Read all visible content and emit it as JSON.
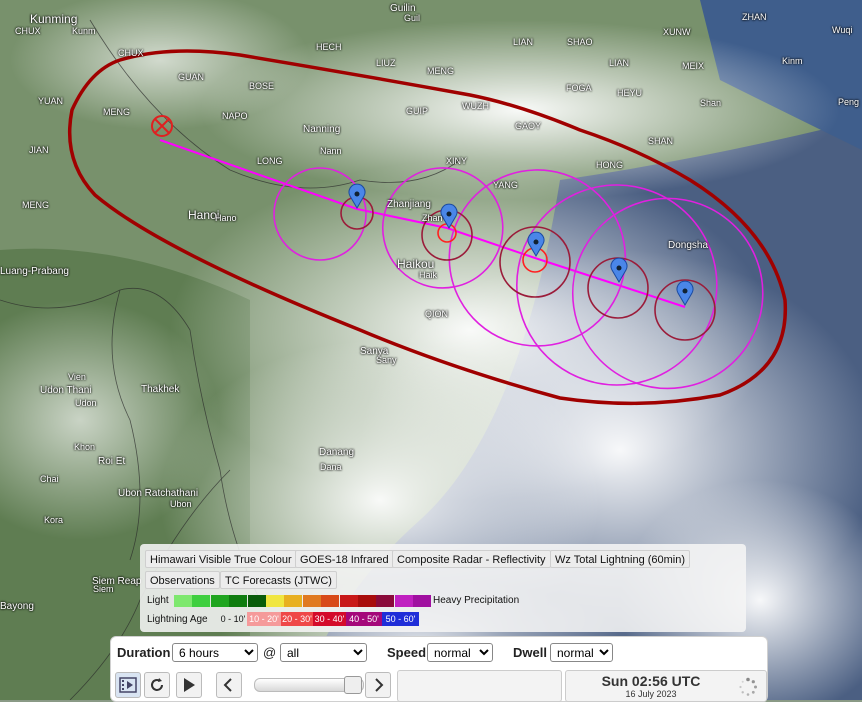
{
  "map": {
    "labels": [
      {
        "text": "Kunming",
        "cls": "big"
      },
      {
        "text": "CHUX",
        "cls": "small"
      },
      {
        "text": "Kunm",
        "cls": "small"
      },
      {
        "text": "CHUX",
        "cls": "small"
      },
      {
        "text": "GUAN",
        "cls": "small"
      },
      {
        "text": "YUAN",
        "cls": "small"
      },
      {
        "text": "MENG",
        "cls": "small"
      },
      {
        "text": "JIAN",
        "cls": "small"
      },
      {
        "text": "MENG",
        "cls": "small"
      },
      {
        "text": "Luang-Prabang",
        "cls": ""
      },
      {
        "text": "HECH",
        "cls": "small"
      },
      {
        "text": "BOSE",
        "cls": "small"
      },
      {
        "text": "NAPO",
        "cls": "small"
      },
      {
        "text": "Nanning",
        "cls": ""
      },
      {
        "text": "Nann",
        "cls": "small"
      },
      {
        "text": "LONG",
        "cls": "small"
      },
      {
        "text": "Hanoi",
        "cls": "big"
      },
      {
        "text": "Hano",
        "cls": "small"
      },
      {
        "text": "Guilin",
        "cls": ""
      },
      {
        "text": "Guil",
        "cls": "small"
      },
      {
        "text": "LIUZ",
        "cls": "small"
      },
      {
        "text": "MENG",
        "cls": "small"
      },
      {
        "text": "GUIP",
        "cls": "small"
      },
      {
        "text": "WUZH",
        "cls": "small"
      },
      {
        "text": "LIAN",
        "cls": "small"
      },
      {
        "text": "SHAO",
        "cls": "small"
      },
      {
        "text": "LIAN",
        "cls": "small"
      },
      {
        "text": "FOGA",
        "cls": "small"
      },
      {
        "text": "HEYU",
        "cls": "small"
      },
      {
        "text": "GAOY",
        "cls": "small"
      },
      {
        "text": "XINY",
        "cls": "small"
      },
      {
        "text": "YANG",
        "cls": "small"
      },
      {
        "text": "HONG",
        "cls": "small"
      },
      {
        "text": "SHAN",
        "cls": "small"
      },
      {
        "text": "Zhanjiang",
        "cls": ""
      },
      {
        "text": "Zhan",
        "cls": "small"
      },
      {
        "text": "Haikou",
        "cls": "big"
      },
      {
        "text": "Haik",
        "cls": "small"
      },
      {
        "text": "QION",
        "cls": "small"
      },
      {
        "text": "Sanya",
        "cls": ""
      },
      {
        "text": "Sany",
        "cls": "small"
      },
      {
        "text": "Dongsha",
        "cls": ""
      },
      {
        "text": "ZHAN",
        "cls": "small"
      },
      {
        "text": "XUNW",
        "cls": "small"
      },
      {
        "text": "MEIX",
        "cls": "small"
      },
      {
        "text": "Shan",
        "cls": "small"
      },
      {
        "text": "Wuqi",
        "cls": "small"
      },
      {
        "text": "Kinm",
        "cls": "small"
      },
      {
        "text": "Peng",
        "cls": "small"
      },
      {
        "text": "Vien",
        "cls": "small"
      },
      {
        "text": "Udon Thani",
        "cls": ""
      },
      {
        "text": "Udon",
        "cls": "small"
      },
      {
        "text": "Thakhek",
        "cls": ""
      },
      {
        "text": "Khon",
        "cls": "small"
      },
      {
        "text": "Roi Et",
        "cls": ""
      },
      {
        "text": "Chai",
        "cls": "small"
      },
      {
        "text": "Ubon Ratchathani",
        "cls": ""
      },
      {
        "text": "Ubon",
        "cls": "small"
      },
      {
        "text": "Kora",
        "cls": "small"
      },
      {
        "text": "Danang",
        "cls": ""
      },
      {
        "text": "Dana",
        "cls": "small"
      },
      {
        "text": "Siem Reap",
        "cls": ""
      },
      {
        "text": "Siem",
        "cls": "small"
      },
      {
        "text": "Bayong",
        "cls": ""
      },
      {
        "text": "ZHAN",
        "cls": "small"
      }
    ]
  },
  "legend": {
    "layers": [
      "Himawari Visible True Colour",
      "GOES-18 Infrared",
      "Composite Radar - Reflectivity",
      "Wz Total Lightning (60min)",
      "Observations",
      "TC Forecasts (JTWC)"
    ],
    "precip_light": "Light",
    "precip_heavy": "Heavy Precipitation",
    "precip_colors": [
      "#7ee86e",
      "#3fcf3f",
      "#1fa51f",
      "#0f7d0f",
      "#0a5c0a",
      "#f0e640",
      "#e8b020",
      "#e07a20",
      "#d84a18",
      "#c81818",
      "#a80c0c",
      "#8a0a3a",
      "#c020c0",
      "#a010a0"
    ],
    "lightning_label": "Lightning Age",
    "lightning_segments": [
      {
        "text": "0 - 10'",
        "color": "transparent",
        "fg": "#111"
      },
      {
        "text": "10 - 20'",
        "color": "#f59a9a",
        "fg": "#fff"
      },
      {
        "text": "20 - 30'",
        "color": "#ef4848",
        "fg": "#fff"
      },
      {
        "text": "30 - 40'",
        "color": "#d40b2a",
        "fg": "#fff"
      },
      {
        "text": "40 - 50'",
        "color": "#a4087a",
        "fg": "#fff"
      },
      {
        "text": "50 - 60'",
        "color": "#1f2ed8",
        "fg": "#fff"
      }
    ]
  },
  "controls": {
    "duration_label": "Duration",
    "duration_value": "6 hours",
    "at_symbol": "@",
    "at_value": "all",
    "speed_label": "Speed",
    "speed_value": "normal",
    "dwell_label": "Dwell",
    "dwell_value": "normal",
    "time_main": "Sun 02:56 UTC",
    "time_date": "16 July 2023",
    "buttons": [
      "filmstrip-icon",
      "refresh-icon",
      "play-icon",
      "step-back-icon",
      "step-forward-icon"
    ]
  },
  "colors": {
    "track_envelope": "#a00000",
    "forecast_track": "#ff00ff",
    "wind_radii": "#e020e0",
    "inner_radii": "#9b1c3a",
    "marker": "#4a86e8"
  }
}
